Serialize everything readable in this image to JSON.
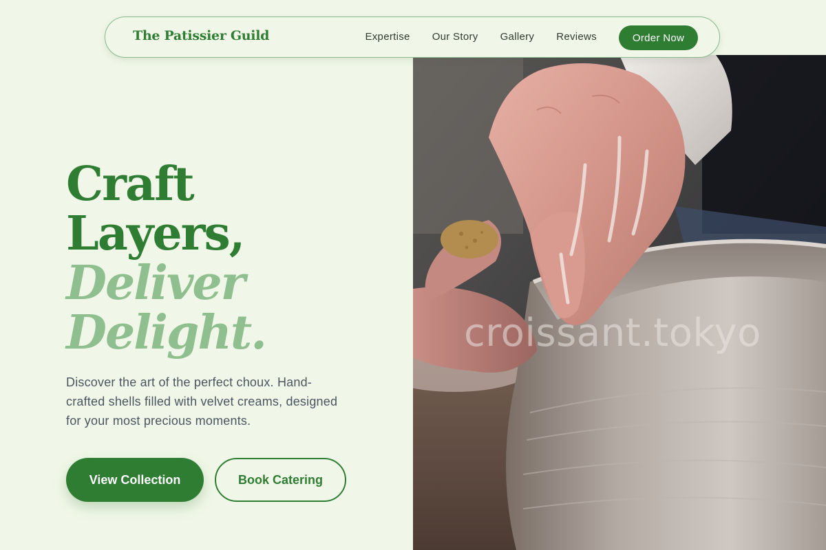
{
  "nav": {
    "brand": "The Patissier Guild",
    "links": [
      "Expertise",
      "Our Story",
      "Gallery",
      "Reviews"
    ],
    "cta": "Order Now"
  },
  "hero": {
    "headline": {
      "line1": "Craft",
      "line2": "Layers,",
      "line3": "Deliver",
      "line4": "Delight."
    },
    "description": "Discover the art of the perfect choux. Hand-crafted shells filled with velvet creams, designed for your most precious moments.",
    "primary_button": "View Collection",
    "secondary_button": "Book Catering",
    "image": {
      "subject": "hands shaping clay on a pottery wheel",
      "watermark": "croissant.tokyo"
    }
  },
  "colors": {
    "background": "#f1f7e8",
    "accent": "#2e7d32",
    "accent_light": "#8fbf8f",
    "body_text": "#4a5560"
  }
}
